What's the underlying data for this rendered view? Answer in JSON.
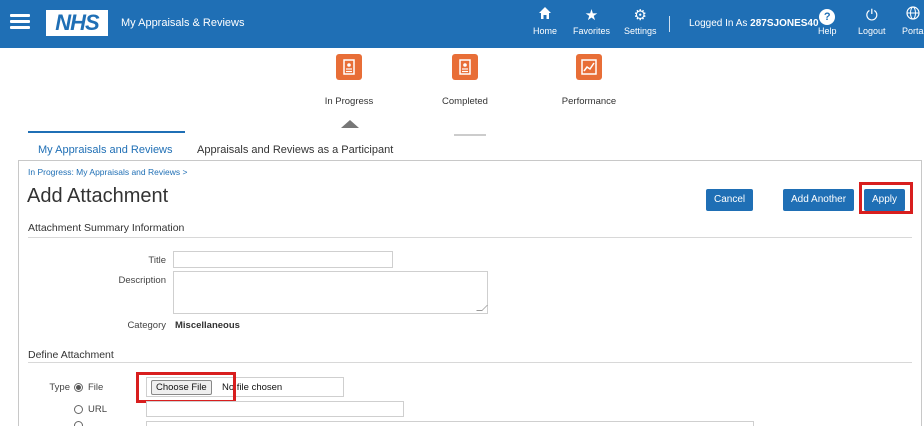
{
  "header": {
    "logo": "NHS",
    "app_title": "My Appraisals & Reviews",
    "nav": [
      {
        "label": "Home",
        "icon": "home-icon"
      },
      {
        "label": "Favorites",
        "icon": "star-icon"
      },
      {
        "label": "Settings",
        "icon": "gear-icon"
      }
    ],
    "logged_in_prefix": "Logged In As",
    "username": "287SJONES40",
    "help_label": "Help",
    "logout_label": "Logout",
    "portal_label": "Porta",
    "bar_color": "#1f6fb5"
  },
  "train": {
    "stages": [
      {
        "label": "In Progress",
        "icon": "clipboard-icon",
        "current": true
      },
      {
        "label": "Completed",
        "icon": "clipboard-check-icon",
        "current": false
      },
      {
        "label": "Performance",
        "icon": "chart-icon",
        "current": false
      }
    ],
    "accent_color": "#e86e37"
  },
  "tabs": [
    {
      "label": "My Appraisals and Reviews",
      "active": true
    },
    {
      "label": "Appraisals and Reviews as a Participant",
      "active": false
    }
  ],
  "breadcrumb": "In Progress: My Appraisals and Reviews >",
  "page_title": "Add Attachment",
  "actions": {
    "cancel": "Cancel",
    "add_another": "Add Another",
    "apply": "Apply"
  },
  "summary_section": {
    "heading": "Attachment Summary Information",
    "title_label": "Title",
    "title_value": "",
    "description_label": "Description",
    "description_value": "",
    "category_label": "Category",
    "category_value": "Miscellaneous"
  },
  "define_section": {
    "heading": "Define Attachment",
    "type_label": "Type",
    "options": {
      "file": "File",
      "url": "URL"
    },
    "selected": "File",
    "choose_file_label": "Choose File",
    "no_file_text": "No file chosen",
    "url_value": ""
  },
  "highlight_color": "#d81e1e"
}
